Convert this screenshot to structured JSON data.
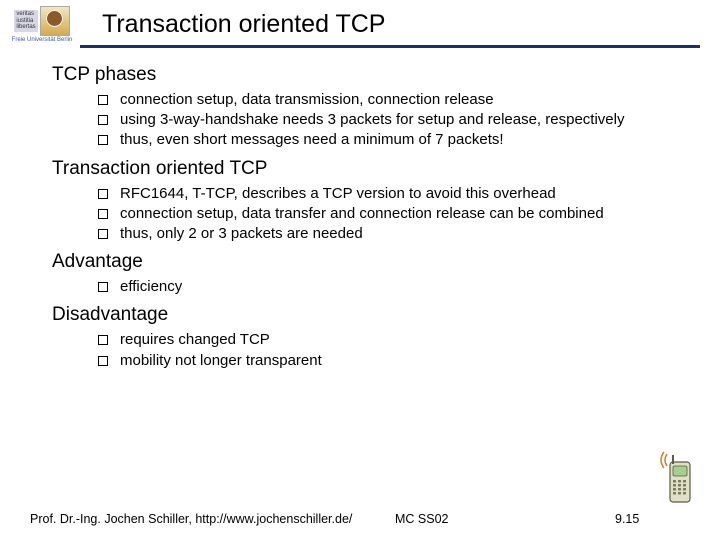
{
  "logo": {
    "motto_line1": "veritas",
    "motto_line2": "iustitia",
    "motto_line3": "libertas",
    "university": "Freie Universität Berlin"
  },
  "title": "Transaction oriented TCP",
  "sections": [
    {
      "heading": "TCP phases",
      "items": [
        "connection setup, data transmission, connection release",
        "using 3-way-handshake needs 3 packets for setup and release, respectively",
        "thus, even short messages need a minimum of 7 packets!"
      ]
    },
    {
      "heading": "Transaction oriented TCP",
      "items": [
        "RFC1644, T-TCP, describes a TCP version to avoid this overhead",
        "connection setup, data transfer and connection release can be combined",
        "thus, only 2 or 3 packets are needed"
      ]
    },
    {
      "heading": "Advantage",
      "items": [
        "efficiency"
      ]
    },
    {
      "heading": "Disadvantage",
      "items": [
        "requires changed TCP",
        "mobility not longer transparent"
      ]
    }
  ],
  "footer": {
    "author": "Prof. Dr.-Ing. Jochen Schiller, http://www.jochenschiller.de/",
    "course": "MC SS02",
    "pagenum": "9.15"
  }
}
